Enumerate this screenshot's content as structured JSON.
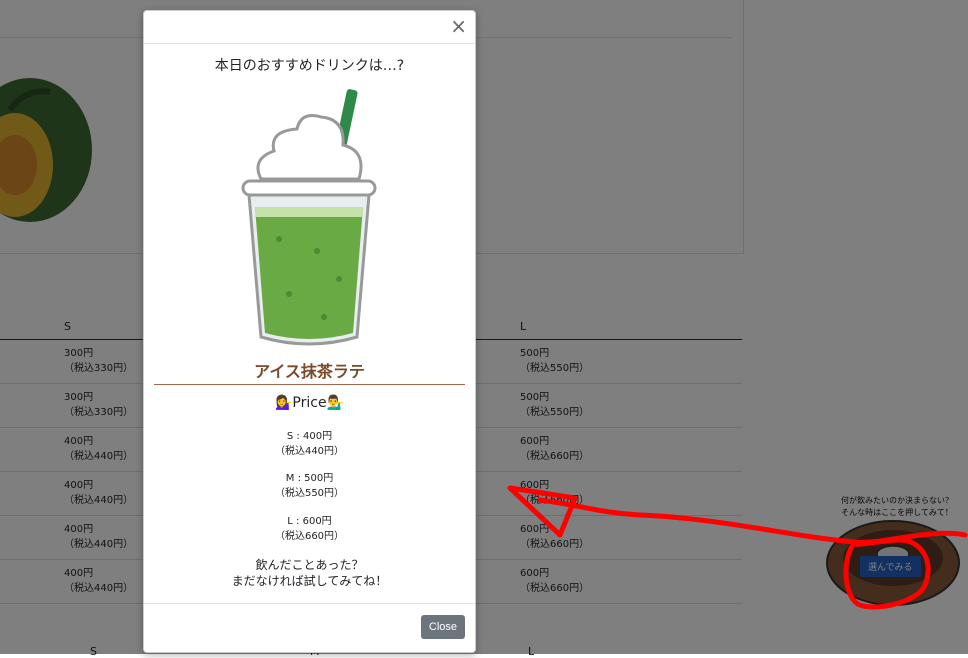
{
  "background": {
    "table_headers": {
      "s": "S",
      "l": "L"
    },
    "rows": [
      {
        "s_price": "300円",
        "s_tax": "（税込330円）",
        "l_price": "500円",
        "l_tax": "（税込550円）"
      },
      {
        "s_price": "300円",
        "s_tax": "（税込330円）",
        "l_price": "500円",
        "l_tax": "（税込550円）"
      },
      {
        "s_price": "400円",
        "s_tax": "（税込440円）",
        "l_price": "600円",
        "l_tax": "（税込660円）"
      },
      {
        "s_price": "400円",
        "s_tax": "（税込440円）",
        "l_price": "600円",
        "l_tax": "（税込660円）"
      },
      {
        "s_price": "400円",
        "s_tax": "（税込440円）",
        "l_price": "600円",
        "l_tax": "（税込660円）"
      },
      {
        "s_price": "400円",
        "s_tax": "（税込440円）",
        "l_price": "600円",
        "l_tax": "（税込660円）"
      }
    ],
    "bottom_headers": {
      "s": "S",
      "m": "M",
      "l": "L"
    }
  },
  "modal": {
    "close_icon": "×",
    "title": "本日のおすすめドリンクは…?",
    "drink_name": "アイス抹茶ラテ",
    "price_title": "💁‍♀️Price💁‍♂️",
    "prices": [
      {
        "label": "S : 400円",
        "tax": "（税込440円）"
      },
      {
        "label": "M : 500円",
        "tax": "（税込550円）"
      },
      {
        "label": "L : 600円",
        "tax": "（税込660円）"
      }
    ],
    "question_line1": "飲んだことあった？",
    "question_line2": "まだなければ試してみてね！",
    "close_button": "Close"
  },
  "chooser": {
    "line1": "何が飲みたいのか決まらない？",
    "line2": "そんな時はここを押してみて！",
    "button": "選んでみる"
  },
  "colors": {
    "overlay": "rgba(0,0,0,0.5)",
    "accent_brown": "#7b4a2a",
    "annotation_red": "#ff0000",
    "button_blue": "#2563c4"
  }
}
